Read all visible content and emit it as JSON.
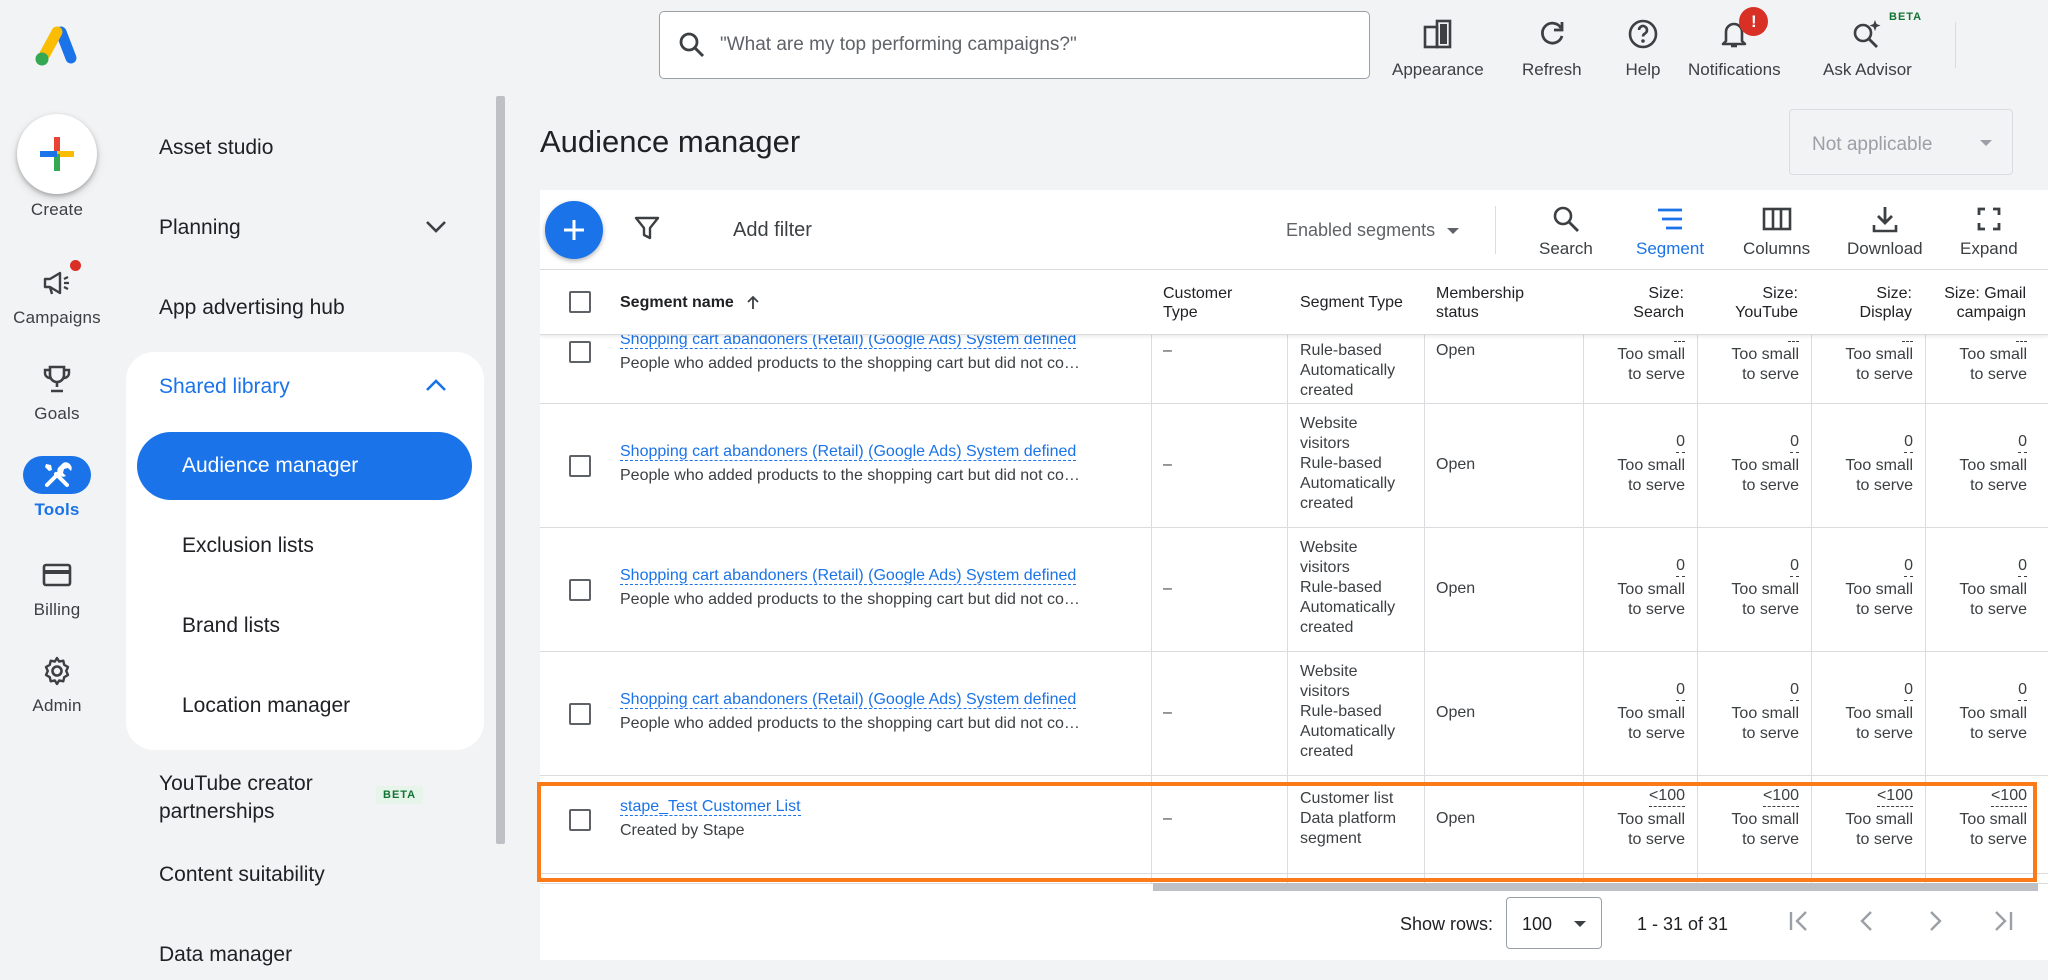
{
  "rail": {
    "create": "Create",
    "campaigns": "Campaigns",
    "goals": "Goals",
    "tools": "Tools",
    "billing": "Billing",
    "admin": "Admin"
  },
  "nav": {
    "asset_studio": "Asset studio",
    "planning": "Planning",
    "app_advertising_hub": "App advertising hub",
    "shared_library": "Shared library",
    "audience_manager": "Audience manager",
    "exclusion_lists": "Exclusion lists",
    "brand_lists": "Brand lists",
    "location_manager": "Location manager",
    "youtube_creator_line1": "YouTube creator",
    "youtube_creator_line2": "partnerships",
    "beta": "BETA",
    "content_suitability": "Content suitability",
    "data_manager": "Data manager"
  },
  "topbar": {
    "search_placeholder": "\"What are my top performing campaigns?\"",
    "appearance": "Appearance",
    "refresh": "Refresh",
    "help": "Help",
    "notifications": "Notifications",
    "notifications_badge": "!",
    "ask_advisor": "Ask Advisor",
    "beta": "BETA"
  },
  "main": {
    "title": "Audience manager",
    "account_select": "Not applicable",
    "add_filter": "Add filter",
    "segments_filter": "Enabled segments",
    "actions": {
      "search": "Search",
      "segment": "Segment",
      "columns": "Columns",
      "download": "Download",
      "expand": "Expand"
    }
  },
  "table": {
    "headers": {
      "segment_name": "Segment name",
      "customer_type_1": "Customer",
      "customer_type_2": "Type",
      "segment_type": "Segment Type",
      "membership_1": "Membership",
      "membership_2": "status",
      "size_search_1": "Size:",
      "size_search_2": "Search",
      "size_youtube_1": "Size:",
      "size_youtube_2": "YouTube",
      "size_display_1": "Size:",
      "size_display_2": "Display",
      "size_gmail_1": "Size: Gmail",
      "size_gmail_2": "campaign"
    },
    "rows": [
      {
        "name": "Shopping cart abandoners (Retail) (Google Ads) System defined",
        "desc": "People who added products to the shopping cart but did not co…",
        "customer_type": "–",
        "type_lines": [
          "Rule-based",
          "Automatically",
          "created"
        ],
        "status": "Open",
        "sizes": [
          {
            "num": "--",
            "l1": "Too small",
            "l2": "to serve"
          },
          {
            "num": "--",
            "l1": "Too small",
            "l2": "to serve"
          },
          {
            "num": "--",
            "l1": "Too small",
            "l2": "to serve"
          },
          {
            "num": "--",
            "l1": "Too small",
            "l2": "to serve"
          }
        ]
      },
      {
        "name": "Shopping cart abandoners (Retail) (Google Ads) System defined",
        "desc": "People who added products to the shopping cart but did not co…",
        "customer_type": "–",
        "type_lines": [
          "Website",
          "visitors",
          "Rule-based",
          "Automatically",
          "created"
        ],
        "status": "Open",
        "sizes": [
          {
            "num": "0",
            "l1": "Too small",
            "l2": "to serve"
          },
          {
            "num": "0",
            "l1": "Too small",
            "l2": "to serve"
          },
          {
            "num": "0",
            "l1": "Too small",
            "l2": "to serve"
          },
          {
            "num": "0",
            "l1": "Too small",
            "l2": "to serve"
          }
        ]
      },
      {
        "name": "Shopping cart abandoners (Retail) (Google Ads) System defined",
        "desc": "People who added products to the shopping cart but did not co…",
        "customer_type": "–",
        "type_lines": [
          "Website",
          "visitors",
          "Rule-based",
          "Automatically",
          "created"
        ],
        "status": "Open",
        "sizes": [
          {
            "num": "0",
            "l1": "Too small",
            "l2": "to serve"
          },
          {
            "num": "0",
            "l1": "Too small",
            "l2": "to serve"
          },
          {
            "num": "0",
            "l1": "Too small",
            "l2": "to serve"
          },
          {
            "num": "0",
            "l1": "Too small",
            "l2": "to serve"
          }
        ]
      },
      {
        "name": "Shopping cart abandoners (Retail) (Google Ads) System defined",
        "desc": "People who added products to the shopping cart but did not co…",
        "customer_type": "–",
        "type_lines": [
          "Website",
          "visitors",
          "Rule-based",
          "Automatically",
          "created"
        ],
        "status": "Open",
        "sizes": [
          {
            "num": "0",
            "l1": "Too small",
            "l2": "to serve"
          },
          {
            "num": "0",
            "l1": "Too small",
            "l2": "to serve"
          },
          {
            "num": "0",
            "l1": "Too small",
            "l2": "to serve"
          },
          {
            "num": "0",
            "l1": "Too small",
            "l2": "to serve"
          }
        ]
      },
      {
        "name": "stape_Test Customer List",
        "desc": "Created by Stape",
        "customer_type": "–",
        "type_lines": [
          "Customer list",
          "Data platform",
          "segment"
        ],
        "status": "Open",
        "sizes": [
          {
            "num": "<100",
            "l1": "Too small",
            "l2": "to serve"
          },
          {
            "num": "<100",
            "l1": "Too small",
            "l2": "to serve"
          },
          {
            "num": "<100",
            "l1": "Too small",
            "l2": "to serve"
          },
          {
            "num": "<100",
            "l1": "Too small",
            "l2": "to serve"
          }
        ]
      }
    ]
  },
  "footer": {
    "show_rows": "Show rows:",
    "rows_value": "100",
    "range": "1 - 31 of 31"
  },
  "colors": {
    "accent": "#1a73e8",
    "highlight": "#fa7b17",
    "alert": "#d93025"
  }
}
